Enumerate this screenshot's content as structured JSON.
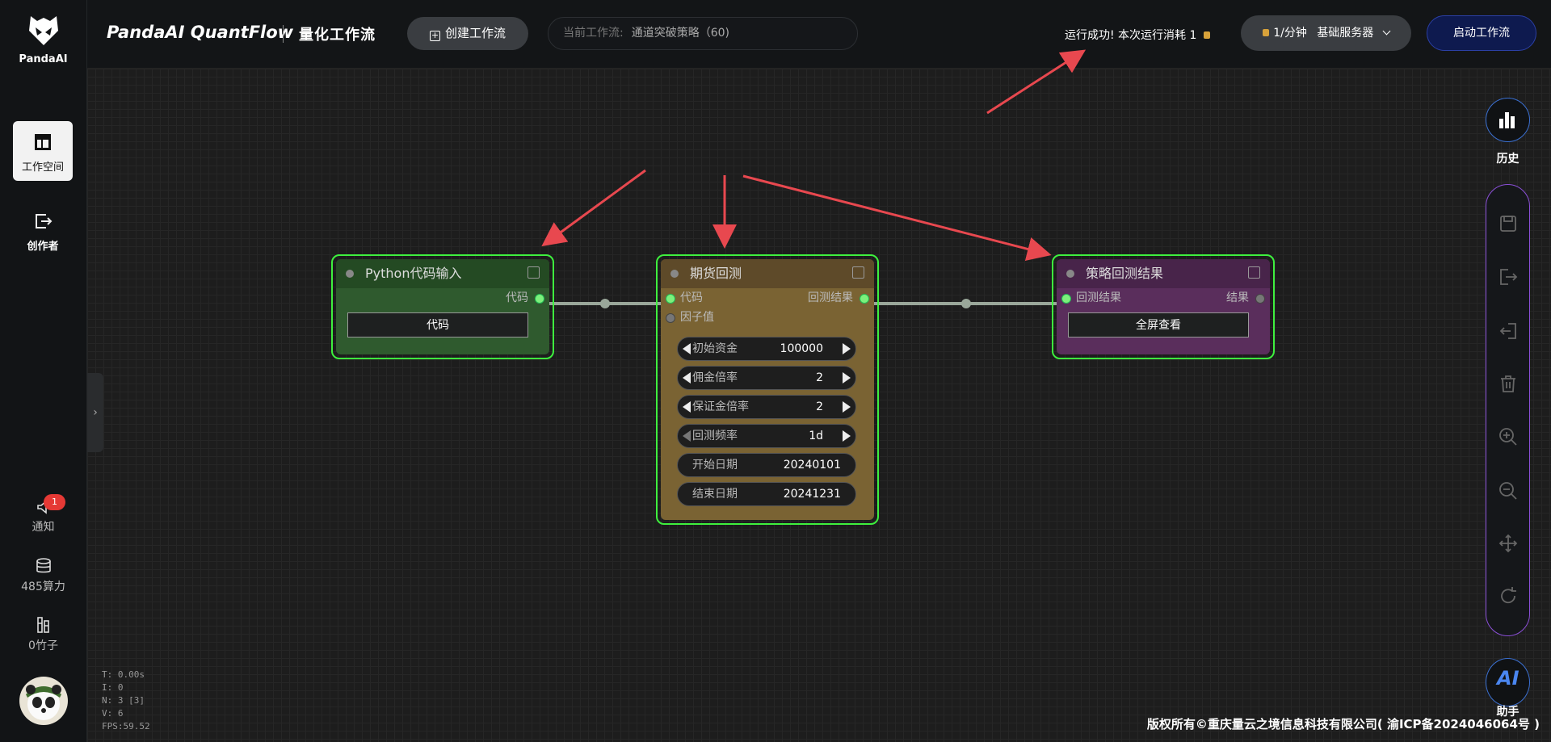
{
  "sidebar": {
    "logo_text": "PandaAI",
    "items": [
      {
        "label": "工作空间",
        "icon": "layout-icon"
      },
      {
        "label": "创作者",
        "icon": "exit-box-icon"
      }
    ],
    "notify": {
      "label": "通知",
      "badge": "1"
    },
    "compute": {
      "label": "485算力"
    },
    "bamboo": {
      "label": "0竹子"
    }
  },
  "header": {
    "brand": "PandaAI QuantFlow",
    "subtitle": "量化工作流",
    "create_label": "创建工作流",
    "current_key": "当前工作流:",
    "current_value": "通道突破策略（60)",
    "run_status": "运行成功!  本次运行消耗 1",
    "speed_label": "1/分钟",
    "server_label": "基础服务器",
    "start_label": "启动工作流"
  },
  "nodes": {
    "python": {
      "title": "Python代码输入",
      "out_port": "代码",
      "button": "代码"
    },
    "futures": {
      "title": "期货回测",
      "in_port1": "代码",
      "in_port2": "因子值",
      "out_port": "回测结果",
      "fields": [
        {
          "label": "初始资金",
          "value": "100000"
        },
        {
          "label": "佣金倍率",
          "value": "2"
        },
        {
          "label": "保证金倍率",
          "value": "2"
        },
        {
          "label": "回测频率",
          "value": "1d"
        },
        {
          "label": "开始日期",
          "value": "20240101"
        },
        {
          "label": "结束日期",
          "value": "20241231"
        }
      ]
    },
    "result": {
      "title": "策略回测结果",
      "in_port": "回测结果",
      "out_port": "结果",
      "button": "全屏查看"
    }
  },
  "right_toolbar": {
    "history_label": "历史",
    "tools": [
      "save-icon",
      "export-icon",
      "import-icon",
      "delete-icon",
      "zoom-in-icon",
      "zoom-out-icon",
      "move-icon",
      "refresh-icon"
    ],
    "ai_text": "AI",
    "assistant_label": "助手"
  },
  "stats": {
    "t": "T: 0.00s",
    "i": "I: 0",
    "n": "N: 3 [3]",
    "v": "V: 6",
    "fps": "FPS:59.52"
  },
  "footer": "版权所有©重庆量云之境信息科技有限公司( 渝ICP备2024046064号 )",
  "colors": {
    "node_border": "#3ef03e",
    "arrow": "#e8484f",
    "accent_blue": "#2b3fa5"
  }
}
